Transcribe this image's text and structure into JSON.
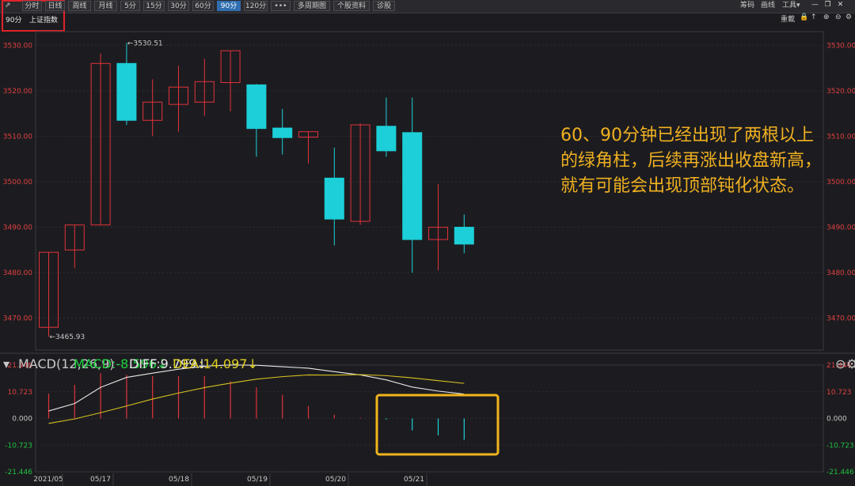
{
  "toolbar": {
    "items": [
      "分时",
      "日线",
      "周线",
      "月线",
      "5分",
      "15分",
      "30分",
      "60分",
      "90分",
      "120分",
      "•••",
      "多周期图",
      "个股资料",
      "诊股"
    ],
    "active_index": 8,
    "right": {
      "chips": "筹码",
      "draw": "画线",
      "tools": "工具▾"
    }
  },
  "header": {
    "period": "90分",
    "index_name": "上证指数",
    "right_label": "重載"
  },
  "annotation": "60、90分钟已经出现了两根以上的绿角柱，后续再涨出收盘新高，就有可能会出现顶部钝化状态。",
  "macd_header": {
    "name": "MACD(12,26,9)",
    "macd": "MACD:-8.596↓",
    "diff": "DIFF:9.799↓",
    "dea": "DEA:14.097↓"
  },
  "colors": {
    "up": "#e0323a",
    "down": "#1ccfd8",
    "diff": "#e8e8e8",
    "dea": "#d8c020",
    "highlight": "#f2b41c",
    "axis": "#e04040"
  },
  "chart_data": [
    {
      "type": "candlestick",
      "ylim": [
        3463,
        3533
      ],
      "y_ticks": [
        3470,
        3480,
        3490,
        3500,
        3510,
        3520,
        3530
      ],
      "y_tick_labels": [
        "3470.00",
        "3480.00",
        "3490.00",
        "3500.00",
        "3510.00",
        "3520.00",
        "3530.00"
      ],
      "x_labels": [
        "2021/05",
        "05/17",
        "05/18",
        "05/19",
        "05/20",
        "05/21"
      ],
      "max_label": "←3530.51",
      "min_label": "←3465.93",
      "candles": [
        {
          "o": 3468.0,
          "h": 3484.5,
          "l": 3465.93,
          "c": 3484.5
        },
        {
          "o": 3485.0,
          "h": 3490.5,
          "l": 3481.0,
          "c": 3490.5
        },
        {
          "o": 3490.5,
          "h": 3528.2,
          "l": 3490.5,
          "c": 3526.0
        },
        {
          "o": 3526.0,
          "h": 3530.51,
          "l": 3512.5,
          "c": 3513.5
        },
        {
          "o": 3513.5,
          "h": 3522.5,
          "l": 3510.0,
          "c": 3517.5
        },
        {
          "o": 3517.0,
          "h": 3525.5,
          "l": 3511.0,
          "c": 3520.8
        },
        {
          "o": 3517.5,
          "h": 3527.0,
          "l": 3514.5,
          "c": 3522.0
        },
        {
          "o": 3521.8,
          "h": 3528.8,
          "l": 3515.5,
          "c": 3528.8
        },
        {
          "o": 3521.3,
          "h": 3521.5,
          "l": 3505.5,
          "c": 3511.7
        },
        {
          "o": 3511.8,
          "h": 3516.0,
          "l": 3506.0,
          "c": 3509.7
        },
        {
          "o": 3509.8,
          "h": 3511.0,
          "l": 3504.0,
          "c": 3511.0
        },
        {
          "o": 3500.8,
          "h": 3507.5,
          "l": 3486.0,
          "c": 3491.8
        },
        {
          "o": 3491.3,
          "h": 3512.8,
          "l": 3490.5,
          "c": 3512.5
        },
        {
          "o": 3512.2,
          "h": 3518.5,
          "l": 3505.5,
          "c": 3506.8
        },
        {
          "o": 3510.8,
          "h": 3518.5,
          "l": 3480.0,
          "c": 3487.3
        },
        {
          "o": 3487.3,
          "h": 3499.5,
          "l": 3480.5,
          "c": 3490.0
        },
        {
          "o": 3490.0,
          "h": 3492.8,
          "l": 3484.3,
          "c": 3486.3
        }
      ]
    },
    {
      "type": "macd",
      "ylim": [
        -21.446,
        21.446
      ],
      "y_ticks": [
        21.446,
        10.723,
        0.0,
        -10.723,
        -21.446
      ],
      "y_tick_labels": [
        "21.446",
        "10.723",
        "0.000",
        "-10.723",
        "-21.446"
      ],
      "histogram": [
        10.0,
        13.5,
        18.2,
        17.5,
        17.0,
        17.0,
        17.0,
        15.0,
        12.5,
        9.5,
        5.0,
        1.5,
        0.3,
        -0.5,
        -4.8,
        -6.8,
        -8.596
      ],
      "diff": [
        3.0,
        6.0,
        12.5,
        16.5,
        18.2,
        19.8,
        21.0,
        21.5,
        21.4,
        20.8,
        20.2,
        18.8,
        17.5,
        15.5,
        12.6,
        11.0,
        9.8
      ],
      "dea": [
        -2.0,
        -0.2,
        2.3,
        5.0,
        7.8,
        10.2,
        12.4,
        14.2,
        15.8,
        16.8,
        17.5,
        17.4,
        17.6,
        17.2,
        16.3,
        15.2,
        14.1
      ]
    }
  ]
}
